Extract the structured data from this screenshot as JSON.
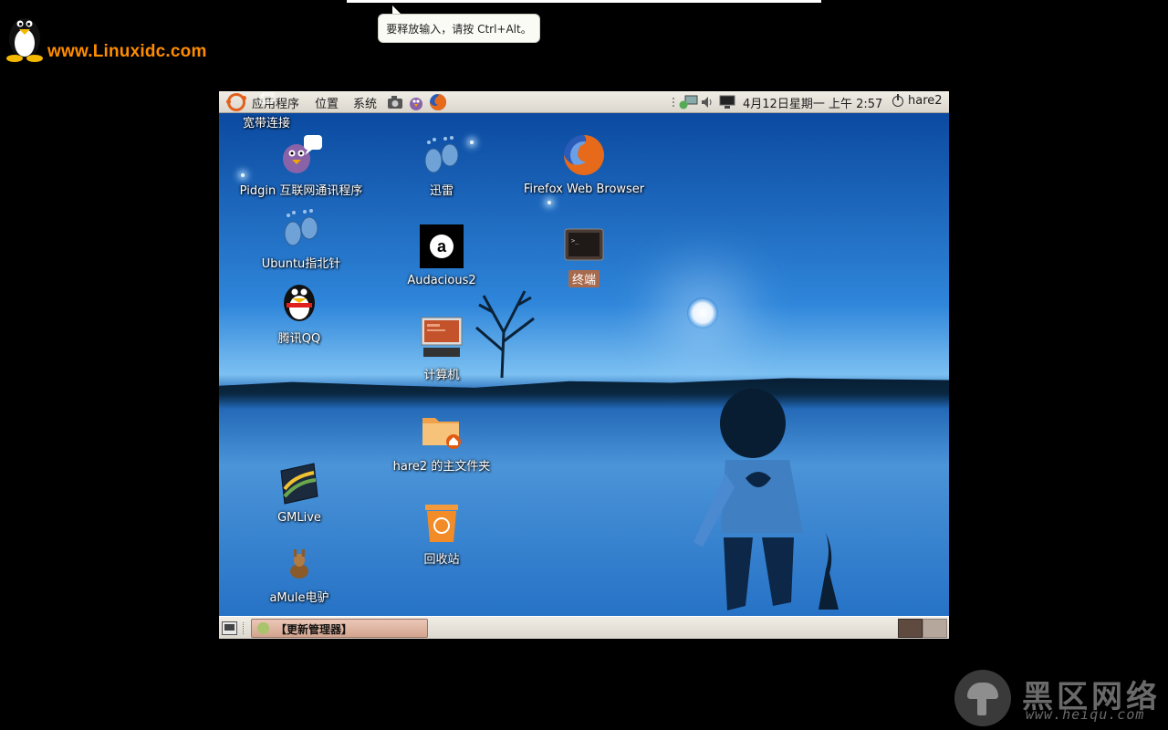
{
  "site_logo": {
    "text": "www.Linuxidc.com",
    "icon": "tux-penguin-icon"
  },
  "tooltip": {
    "text": "要释放输入，请按 Ctrl+Alt。"
  },
  "top_panel": {
    "menus": [
      "应用程序",
      "位置",
      "系统"
    ],
    "launchers": [
      "screenshot-camera-icon",
      "pidgin-icon",
      "firefox-icon"
    ],
    "tray": [
      "network-icon",
      "volume-icon",
      "display-icon"
    ],
    "clock": "4月12日星期一 上午 2:57",
    "user": "hare2"
  },
  "desktop_icons": [
    {
      "label": "Pidgin 互联网通讯程序",
      "icon": "pidgin-icon"
    },
    {
      "label": "迅雷",
      "icon": "thunder-footprint-icon"
    },
    {
      "label": "Firefox Web Browser",
      "icon": "firefox-icon"
    },
    {
      "label": "Ubuntu指北针",
      "icon": "ubuntu-guide-footprint-icon"
    },
    {
      "label": "Audacious2",
      "icon": "audacious-icon"
    },
    {
      "label": "终端",
      "icon": "terminal-icon",
      "selected": true
    },
    {
      "label": "腾讯QQ",
      "icon": "qq-penguin-icon"
    },
    {
      "label": "计算机",
      "icon": "computer-icon"
    },
    {
      "label": "宽带连接",
      "icon": "broadband-connection-icon"
    },
    {
      "label": "hare2 的主文件夹",
      "icon": "home-folder-icon"
    },
    {
      "label": "GMLive",
      "icon": "gmlive-icon"
    },
    {
      "label": "回收站",
      "icon": "trash-icon"
    },
    {
      "label": "aMule电驴",
      "icon": "amule-icon"
    }
  ],
  "bottom_panel": {
    "task": "【更新管理器】",
    "workspaces": 2
  },
  "watermark": {
    "title": "黑区网络",
    "url": "www.heiqu.com"
  },
  "colors": {
    "panel": "#e6e2da",
    "selected_label": "#a86a4c",
    "site_text": "#ff8c00"
  }
}
